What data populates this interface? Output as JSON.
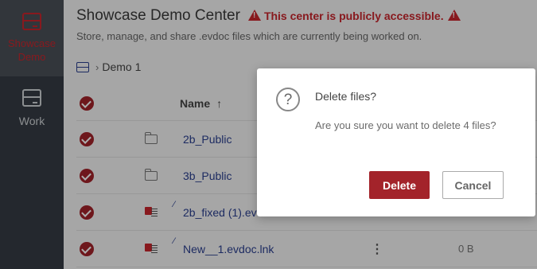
{
  "sidebar": {
    "items": [
      {
        "label": "Showcase Demo",
        "icon": "drive-icon",
        "active": true
      },
      {
        "label": "Work",
        "icon": "drive-icon",
        "active": false
      }
    ]
  },
  "header": {
    "title": "Showcase Demo Center",
    "warning": "This center is publicly accessible.",
    "subtitle": "Store, manage, and share .evdoc files which are currently being worked on."
  },
  "breadcrumb": {
    "icon": "drive-icon",
    "current": "Demo 1"
  },
  "table": {
    "header": {
      "name": "Name",
      "sort_icon": "↑"
    },
    "rows": [
      {
        "type": "folder",
        "name": "2b_Public",
        "selected": true
      },
      {
        "type": "folder",
        "name": "3b_Public",
        "selected": true
      },
      {
        "type": "evdoc",
        "name": "2b_fixed (1).evdoc",
        "selected": true
      },
      {
        "type": "evdoc-link",
        "name": "New__1.evdoc.lnk",
        "selected": true,
        "size": "0 B",
        "more_icon": "⋮"
      }
    ]
  },
  "dialog": {
    "title": "Delete files?",
    "message": "Are you sure you want to delete 4 files?",
    "confirm_label": "Delete",
    "cancel_label": "Cancel"
  },
  "colors": {
    "accent": "#a3232a",
    "link": "#2a3f8f",
    "sidebar": "#353c44"
  }
}
